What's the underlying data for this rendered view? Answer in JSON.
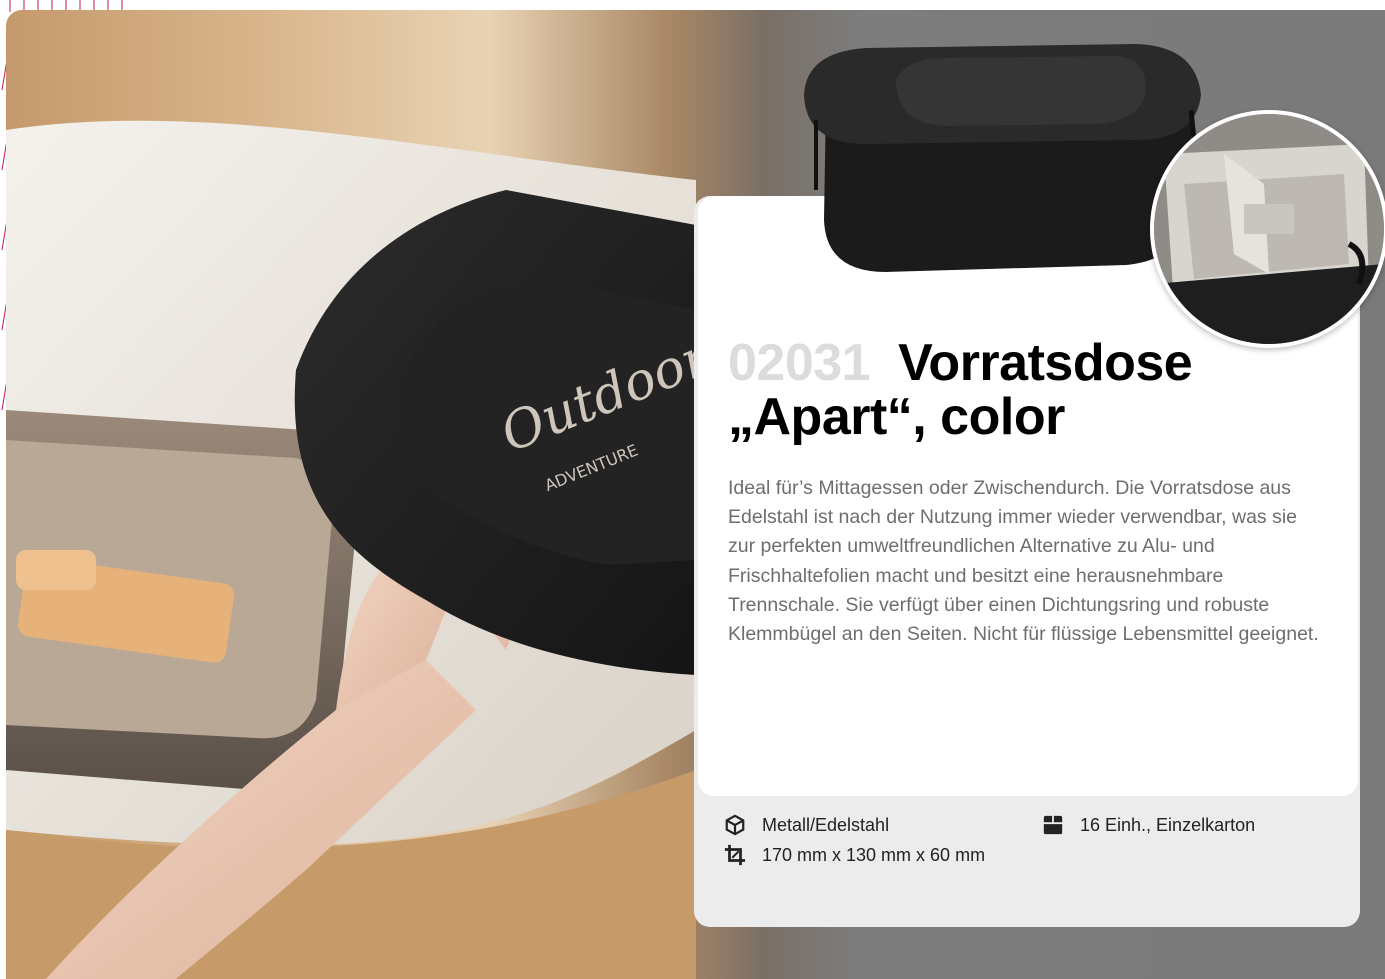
{
  "product": {
    "number": "02031",
    "title_line1": "Vorratsdose",
    "title_line2": "„Apart“, color",
    "description": "Ideal für’s Mittagessen oder Zwischendurch. Die Vorratsdose aus Edelstahl ist nach der Nutzung immer wieder verwendbar, was sie zur perfekten umweltfreundlichen Alternative zu Alu- und Frischhaltefolien macht und besitzt eine herausnehmbare Trennschale. Sie verfügt über einen Dichtungsring und robuste Klemmbügel an den Seiten. Nicht für flüssige Lebensmittel geeignet."
  },
  "specs": {
    "material": {
      "icon": "box-icon",
      "text": "Metall/Edelstahl"
    },
    "dimensions": {
      "icon": "crop-icon",
      "text": "170 mm x 130 mm x 60 mm"
    },
    "packaging": {
      "icon": "carton-icon",
      "text": "16 Einh., Einzelkarton"
    }
  },
  "photo": {
    "lid_print_line1": "Outdoor",
    "lid_print_line2": "ADVENTURE"
  },
  "colors": {
    "accent": "#c2185b",
    "card_bg": "#ececec",
    "number_gray": "#dcdcdc",
    "text_gray": "#6e6e6e"
  }
}
